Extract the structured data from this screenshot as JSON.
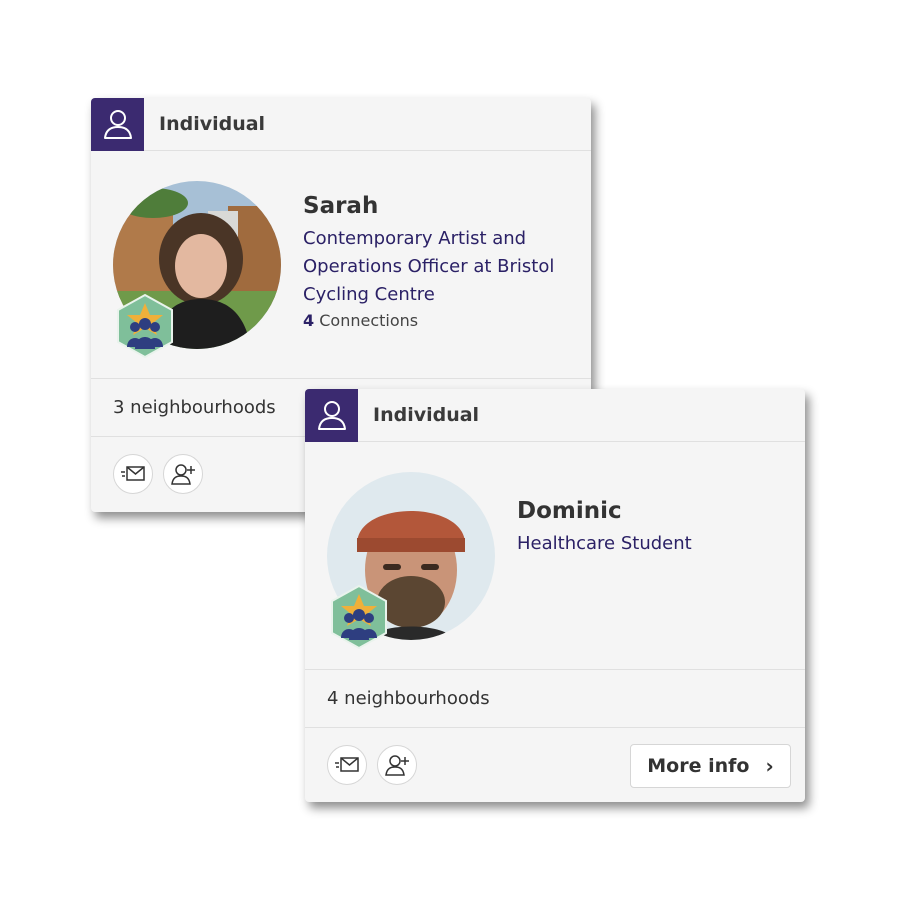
{
  "cards": [
    {
      "type_label": "Individual",
      "type_icon": "person-outline-icon",
      "name": "Sarah",
      "headline": "Contemporary Artist and Operations Officer at Bristol Cycling Centre",
      "connections_count": "4",
      "connections_label": "Connections",
      "neighbourhoods": "3 neighbourhoods",
      "badge_icon": "community-star-badge-icon"
    },
    {
      "type_label": "Individual",
      "type_icon": "person-outline-icon",
      "name": "Dominic",
      "headline": "Healthcare Student",
      "neighbourhoods": "4 neighbourhoods",
      "badge_icon": "community-star-badge-icon",
      "more_info_label": "More info"
    }
  ],
  "colors": {
    "header_icon_bg": "#3b2a70",
    "headline_text": "#2b2166",
    "card_bg": "#f5f5f5",
    "badge_green": "#7fbf9a",
    "badge_star": "#f0b03a"
  },
  "actions": [
    "message-icon",
    "add-connection-icon"
  ]
}
